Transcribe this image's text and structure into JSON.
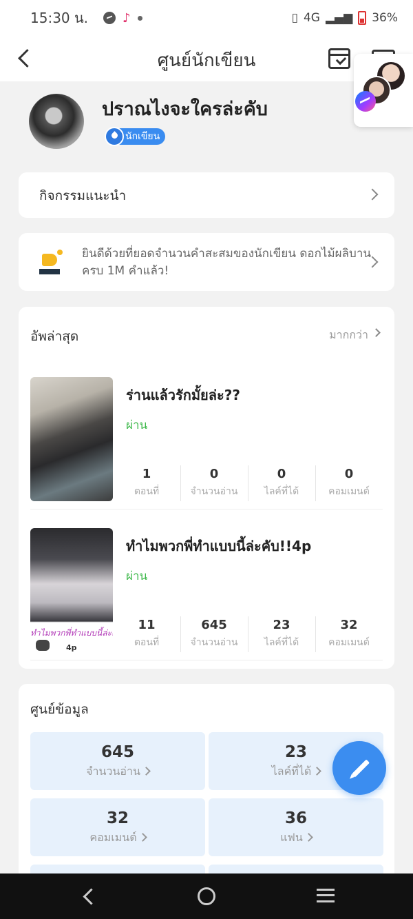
{
  "status_bar": {
    "time": "15:30 น.",
    "network": "4G",
    "battery": "36%"
  },
  "header": {
    "title": "ศูนย์นักเขียน"
  },
  "profile": {
    "name": "ปราณไงจะใครล่ะคับ",
    "badge": "นักเขียน"
  },
  "activity": {
    "label": "กิจกรรมแนะนำ"
  },
  "congrats": {
    "message": "ยินดีด้วยที่ยอดจำนวนคำสะสมของนักเขียน ดอกไม้ผลิบาน ครบ 1M คำแล้ว!"
  },
  "latest": {
    "title": "อัพล่าสุด",
    "more_label": "มากกว่า",
    "books": [
      {
        "title": "ร่านแล้วรักมั้ยล่ะ??",
        "status": "ผ่าน",
        "stats": [
          {
            "value": "1",
            "label": "ตอนที่"
          },
          {
            "value": "0",
            "label": "จำนวนอ่าน"
          },
          {
            "value": "0",
            "label": "ไลค์ที่ได้"
          },
          {
            "value": "0",
            "label": "คอมเมนต์"
          }
        ]
      },
      {
        "title": "ทำไมพวกพี่ทำแบบนี้ล่ะคับ!!4p",
        "status": "ผ่าน",
        "cover_text": "ทำไมพวกพี่ทำแบบนี้ล่ะคับ",
        "cover_sub": "4p",
        "stats": [
          {
            "value": "11",
            "label": "ตอนที่"
          },
          {
            "value": "645",
            "label": "จำนวนอ่าน"
          },
          {
            "value": "23",
            "label": "ไลค์ที่ได้"
          },
          {
            "value": "32",
            "label": "คอมเมนต์"
          }
        ]
      }
    ]
  },
  "data_center": {
    "title": "ศูนย์ข้อมูล",
    "tiles": [
      {
        "value": "645",
        "label": "จำนวนอ่าน"
      },
      {
        "value": "23",
        "label": "ไลค์ที่ได้"
      },
      {
        "value": "32",
        "label": "คอมเมนต์"
      },
      {
        "value": "36",
        "label": "แฟน"
      }
    ]
  },
  "icons": {
    "back": "back-arrow-icon",
    "calendar": "calendar-check-icon",
    "more": "more-icon",
    "messenger": "messenger-icon",
    "trophy": "trophy-icon",
    "edit": "pencil-icon"
  },
  "colors": {
    "accent": "#3b8df0",
    "status_pass": "#3db84a",
    "tile_bg": "#e7f1fc"
  }
}
